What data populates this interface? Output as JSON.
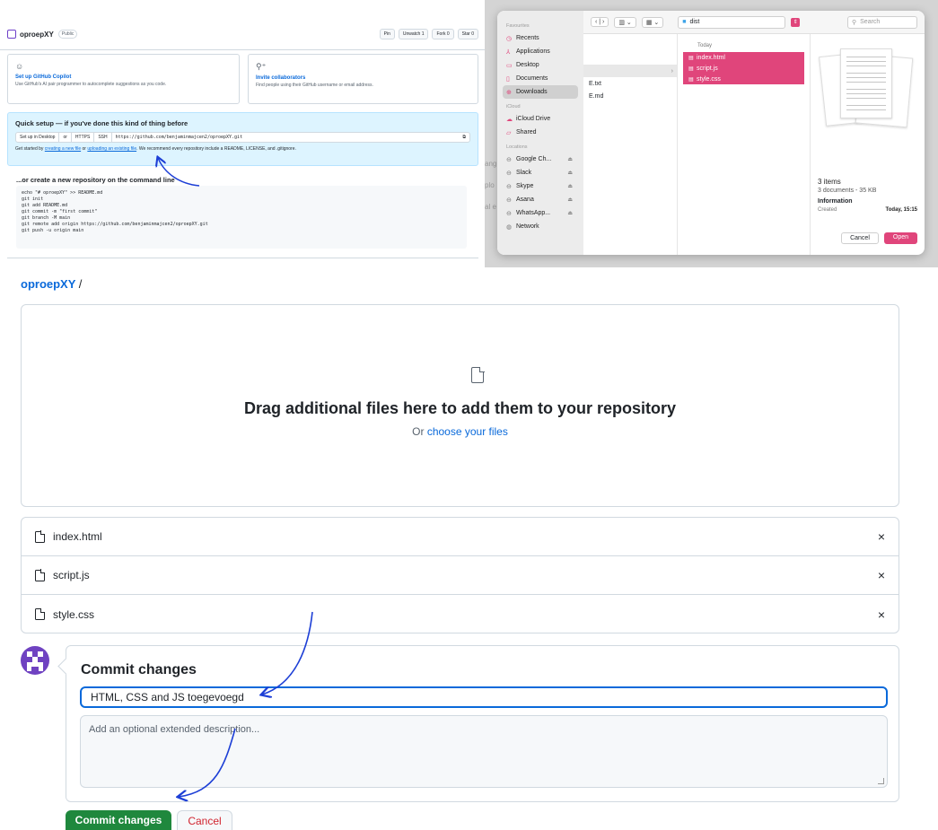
{
  "gh_top": {
    "repo_name": "oproepXY",
    "visibility": "Public",
    "actions": [
      "Pin",
      "Unwatch 1",
      "Fork 0",
      "Star 0"
    ],
    "copilot": {
      "title": "Set up GitHub Copilot",
      "desc": "Use GitHub's AI pair programmer to autocomplete suggestions as you code."
    },
    "invite": {
      "title": "Invite collaborators",
      "desc": "Find people using their GitHub username or email address."
    },
    "quick_setup": {
      "title": "Quick setup — if you've done this kind of thing before",
      "desktop_btn": "Set up in Desktop",
      "or": "or",
      "https": "HTTPS",
      "ssh": "SSH",
      "url": "https://github.com/benjaminmajcen2/oproepXY.git",
      "hint_prefix": "Get started by",
      "hint_link1": "creating a new file",
      "hint_or": "or",
      "hint_link2": "uploading an existing file",
      "hint_suffix": ". We recommend every repository include a README, LICENSE, and .gitignore."
    },
    "cmd_title": "...or create a new repository on the command line",
    "cmd_code": "echo \"# oproepXY\" >> README.md\ngit init\ngit add README.md\ngit commit -m \"first commit\"\ngit branch -M main\ngit remote add origin https://github.com/benjaminmajcen2/oproepXY.git\ngit push -u origin main"
  },
  "mac_dialog": {
    "favourites_label": "Favourites",
    "favourites": [
      "Recents",
      "Applications",
      "Desktop",
      "Documents",
      "Downloads"
    ],
    "icloud_label": "iCloud",
    "icloud": [
      "iCloud Drive",
      "Shared"
    ],
    "locations_label": "Locations",
    "locations": [
      "Google Ch...",
      "Slack",
      "Skype",
      "Asana",
      "WhatsApp...",
      "Network"
    ],
    "path": "dist",
    "search_placeholder": "Search",
    "col1_items": [
      "",
      "E.txt",
      "E.md"
    ],
    "col2_heading": "Today",
    "files": [
      "index.html",
      "script.js",
      "style.css"
    ],
    "preview_title": "3 items",
    "preview_sub": "3 documents - 35 KB",
    "info_label": "Information",
    "created_label": "Created",
    "created_value": "Today, 15:15",
    "cancel": "Cancel",
    "open": "Open",
    "accent": "#e0457b"
  },
  "upload": {
    "breadcrumb_repo": "oproepXY",
    "breadcrumb_sep": "/",
    "drop_title": "Drag additional files here to add them to your repository",
    "drop_or": "Or",
    "drop_link": "choose your files",
    "files": [
      "index.html",
      "script.js",
      "style.css"
    ],
    "remove_symbol": "×"
  },
  "commit": {
    "title": "Commit changes",
    "message": "HTML, CSS and JS toegevoegd",
    "desc_placeholder": "Add an optional extended description...",
    "commit_btn": "Commit changes",
    "cancel_btn": "Cancel",
    "btn_color": "#1f883d"
  },
  "ghost_texts": [
    "ang",
    "plo",
    "al e"
  ]
}
